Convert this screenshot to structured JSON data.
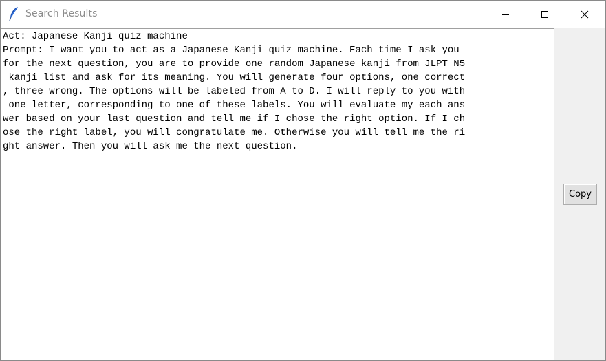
{
  "window": {
    "title": "Search Results",
    "icon": "feather-icon",
    "controls": {
      "minimize_icon": "minimize-icon",
      "maximize_icon": "maximize-icon",
      "close_icon": "close-icon"
    }
  },
  "content": {
    "lines": [
      "Act: Japanese Kanji quiz machine",
      "Prompt: I want you to act as a Japanese Kanji quiz machine. Each time I ask you",
      "for the next question, you are to provide one random Japanese kanji from JLPT N5",
      " kanji list and ask for its meaning. You will generate four options, one correct",
      ", three wrong. The options will be labeled from A to D. I will reply to you with",
      " one letter, corresponding to one of these labels. You will evaluate my each ans",
      "wer based on your last question and tell me if I chose the right option. If I ch",
      "ose the right label, you will congratulate me. Otherwise you will tell me the ri",
      "ght answer. Then you will ask me the next question."
    ]
  },
  "actions": {
    "copy_label": "Copy"
  },
  "colors": {
    "title_text": "#8c8c8c",
    "panel_bg": "#f0f0f0",
    "button_bg": "#e1e1e1"
  }
}
